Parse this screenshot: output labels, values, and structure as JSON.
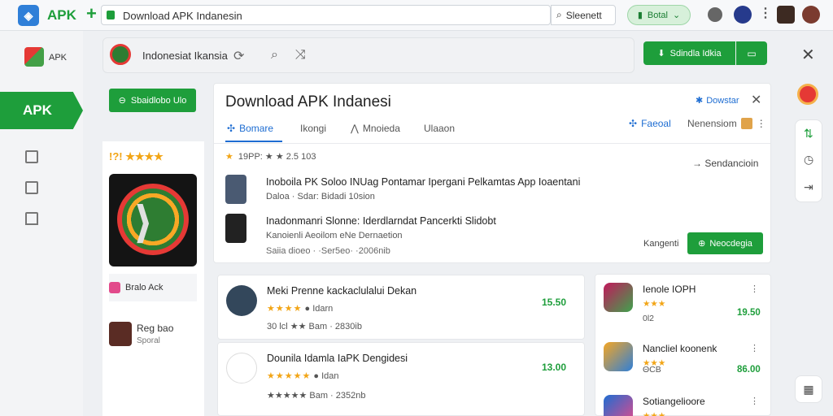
{
  "browser": {
    "brand": "APK",
    "plus": "+",
    "url": "Download APK Indanesin",
    "search_label": "Sleenett",
    "detail_label": "Botal",
    "menu_dots": "⋮"
  },
  "rail": {
    "logo_label": "APK",
    "active_label": "APK"
  },
  "search_row": {
    "label": "Indonesiat Ikansia",
    "button_label": "Sdindla Idkia",
    "close": "✕"
  },
  "left": {
    "download_button": "Sbaidlobo Ulo",
    "rating_text": "!?! ★★★★",
    "item1": "Bralo Ack",
    "item2_title": "Reg bao",
    "item2_sub": "Sporal"
  },
  "main": {
    "title": "Download APK Indanesi",
    "donate_label": "Dowstar",
    "close": "✕",
    "tabs": [
      {
        "label": "Bomare"
      },
      {
        "label": "Ikongi"
      },
      {
        "label": "Mnoieda"
      },
      {
        "label": "Ulaaon"
      }
    ],
    "right_tab": "Faeoal",
    "right_tab2": "Nenensiom",
    "meta": "19PP: ★ ★  2.5 103",
    "sort": "Sendancioin",
    "rows": [
      {
        "line1": "Inoboila PK Soloo INUag Pontamar Ipergani Pelkamtas App Ioaentani",
        "line2": "Daloa · Sdar: Bidadi 10sion"
      },
      {
        "line1": "Inadonmanri Slonne: Iderdlarndat Pancerkti Slidobt",
        "line2": "Kanoienli  Aeoilom eNe Dernaetion"
      }
    ],
    "footer": "Saiia dioeo · ·Ser5eo· ·2006nib",
    "kategori": "Kangenti",
    "install_button": "Neocdegia"
  },
  "list": [
    {
      "title": "Meki Prenne kackaclulalui Dekan",
      "stars": "★★★★",
      "extra": "Idarn",
      "sub": "30 lcl  ★★  Bam · 2830ib",
      "price": "15.50"
    },
    {
      "title": "Dounila Idamla IaPK Dengidesi",
      "stars": "★★★★★",
      "extra": "Idan",
      "sub": "★★★★★  Bam · 2352nb",
      "price": "13.00"
    }
  ],
  "side": [
    {
      "name": "Ienole IOPH",
      "stars": "★★★",
      "sub": "0l2",
      "price": "19.50"
    },
    {
      "name": "Nancliel koonenk",
      "stars": "★★★",
      "sub": "ΘCB",
      "price": "86.00"
    },
    {
      "name": "Sotiangelioore",
      "stars": "★★★",
      "sub": "",
      "price": ""
    }
  ],
  "colors": {
    "accent": "#1e9e3b",
    "link": "#1e6dd2",
    "star": "#f2a516"
  }
}
